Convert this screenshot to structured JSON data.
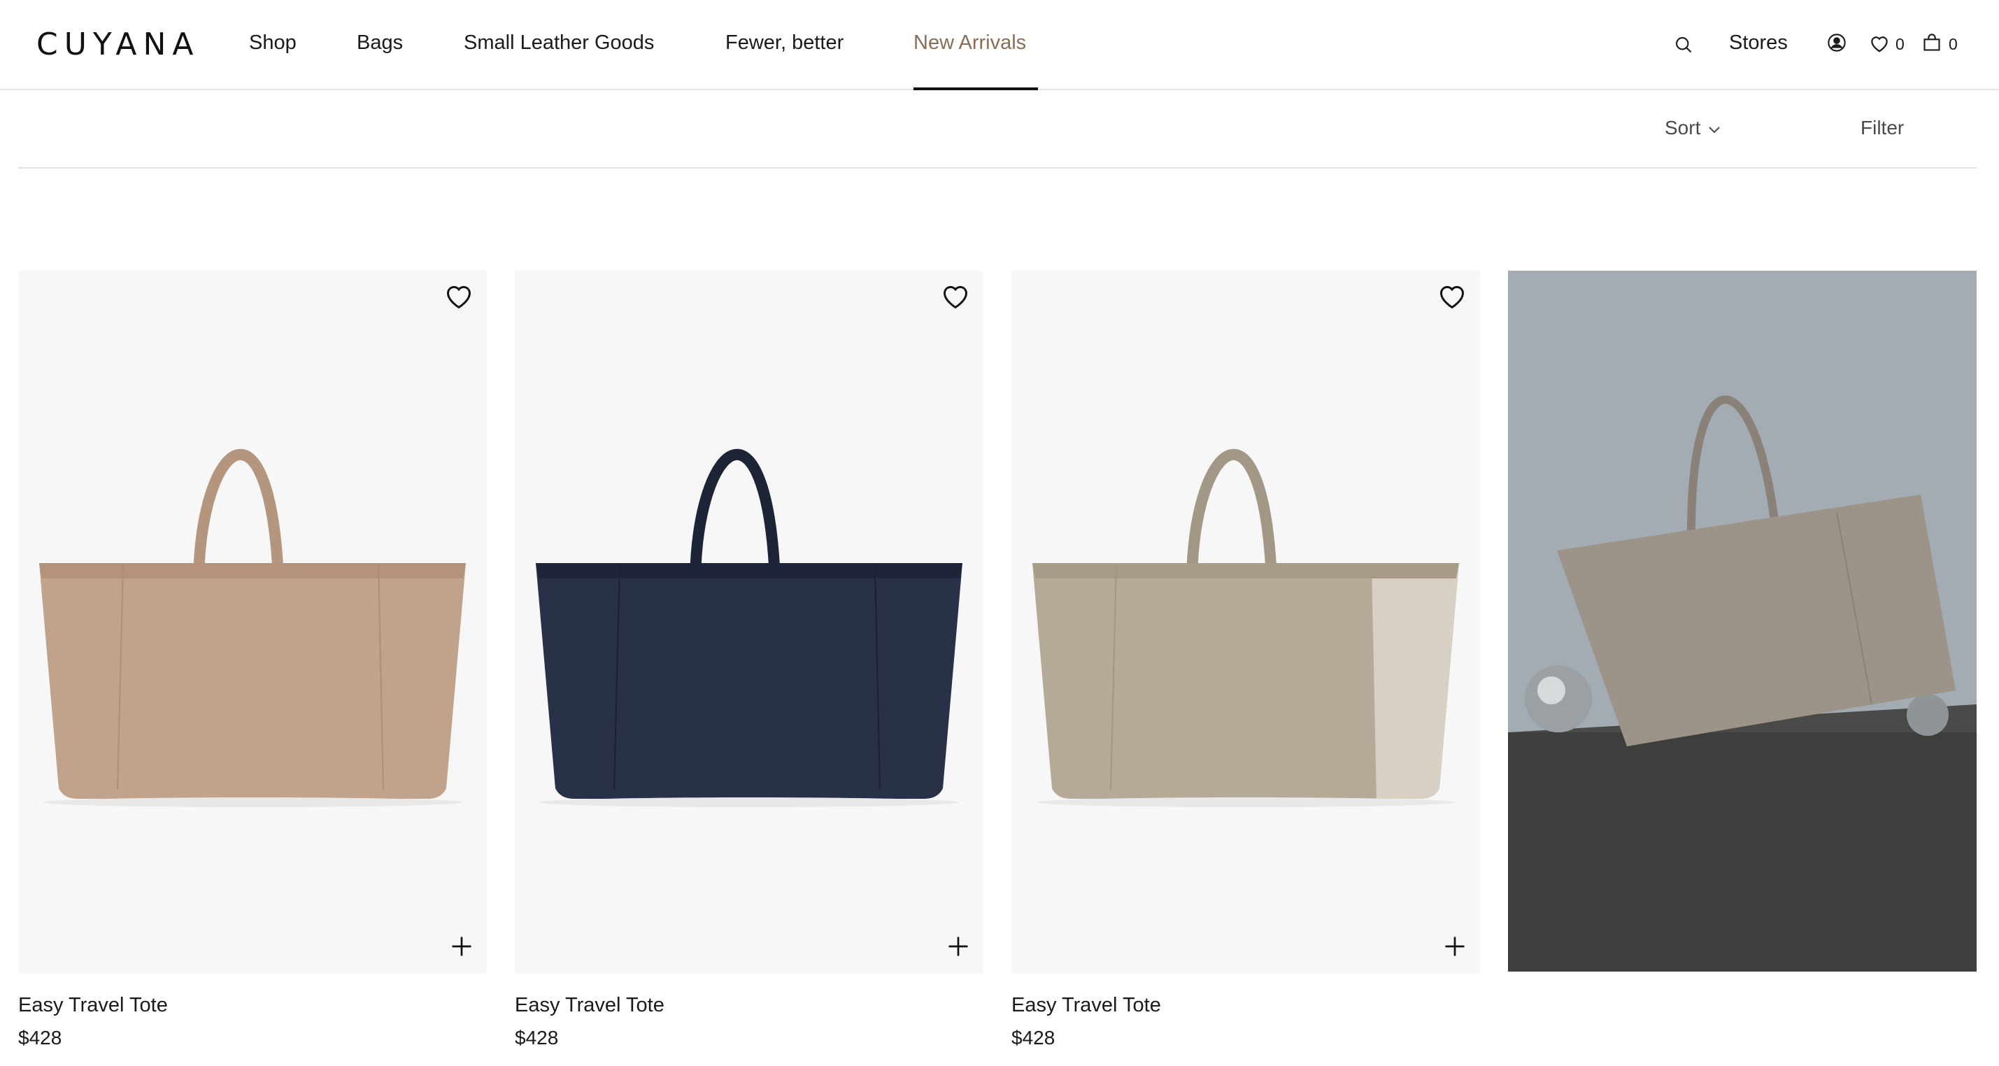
{
  "brand": {
    "logo": "CUYANA"
  },
  "nav": {
    "items": [
      {
        "label": "Shop"
      },
      {
        "label": "Bags"
      },
      {
        "label": "Small Leather Goods"
      },
      {
        "label": "Fewer, better"
      },
      {
        "label": "New Arrivals",
        "active": true
      }
    ]
  },
  "utility": {
    "search_icon": "search-icon",
    "stores_label": "Stores",
    "account_icon": "user-icon",
    "wishlist_icon": "heart-icon",
    "wishlist_count": "0",
    "cart_icon": "bag-icon",
    "cart_count": "0"
  },
  "toolbar": {
    "sort_label": "Sort",
    "filter_label": "Filter"
  },
  "products": [
    {
      "name": "Easy Travel Tote",
      "price": "$428",
      "color": "#c1a28a"
    },
    {
      "name": "Easy Travel Tote",
      "price": "$428",
      "color": "#283148"
    },
    {
      "name": "Easy Travel Tote",
      "price": "$428",
      "color": "#b5aa98"
    }
  ],
  "colors": {
    "accent": "#8a6e57",
    "divider": "#e2e2e2",
    "image_bg": "#f7f7f7",
    "editorial_wall": "#a3acb3",
    "editorial_plinth": "#3e3f3d"
  }
}
